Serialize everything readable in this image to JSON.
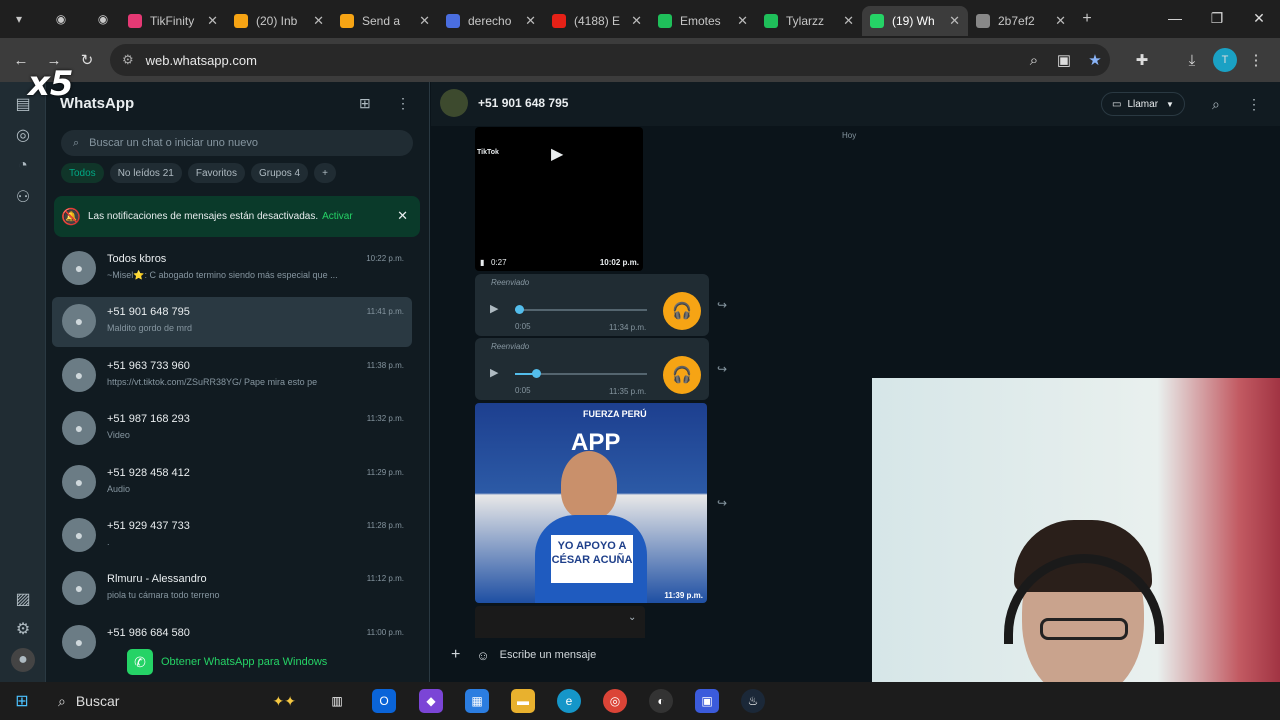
{
  "browser": {
    "tabs": [
      {
        "title": "TikFinity",
        "color": "#e53974"
      },
      {
        "title": "(20) Inb",
        "color": "#f6a414"
      },
      {
        "title": "Send a",
        "color": "#f6a414"
      },
      {
        "title": "derecho",
        "color": "#4a6ee0"
      },
      {
        "title": "(4188) E",
        "color": "#e62117"
      },
      {
        "title": "Emotes",
        "color": "#1fbf5a"
      },
      {
        "title": "Tylarzz",
        "color": "#1fbf5a"
      },
      {
        "title": "(19) Wh",
        "color": "#25d366"
      },
      {
        "title": "2b7ef2",
        "color": "#888888"
      }
    ],
    "url": "web.whatsapp.com"
  },
  "app": {
    "title": "WhatsApp",
    "search_placeholder": "Buscar un chat o iniciar uno nuevo",
    "filters": [
      "Todos",
      "No leídos 21",
      "Favoritos",
      "Grupos 4",
      "+"
    ],
    "notice": {
      "text": "Las notificaciones de mensajes están desactivadas.",
      "action": "Activar"
    },
    "chats": [
      {
        "name": "Todos kbros",
        "time": "10:22 p.m.",
        "preview": "~Misel⭐: C abogado termino siendo más especial que ..."
      },
      {
        "name": "+51 901 648 795",
        "time": "11:41 p.m.",
        "preview": "Maldito gordo de mrd"
      },
      {
        "name": "+51 963 733 960",
        "time": "11:38 p.m.",
        "preview": "https://vt.tiktok.com/ZSuRR38YG/  Pape mira esto pe"
      },
      {
        "name": "+51 987 168 293",
        "time": "11:32 p.m.",
        "preview": "Video"
      },
      {
        "name": "+51 928 458 412",
        "time": "11:29 p.m.",
        "preview": "Audio"
      },
      {
        "name": "+51 929 437 733",
        "time": "11:28 p.m.",
        "preview": "."
      },
      {
        "name": "Rlmuru - Alessandro",
        "time": "11:12 p.m.",
        "preview": "piola tu cámara todo terreno"
      },
      {
        "name": "+51 986 684 580",
        "time": "11:00 p.m.",
        "preview": ""
      }
    ],
    "get_windows": "Obtener WhatsApp para Windows",
    "conversation": {
      "contact": "+51 901 648 795",
      "call": "Llamar",
      "date_chip": "Hoy",
      "video": {
        "duration": "0:27",
        "time": "10:02 p.m.",
        "brand": "TikTok"
      },
      "audios": [
        {
          "forwarded": "Reenviado",
          "duration": "0:05",
          "time": "11:34 p.m.",
          "progress": 0.0
        },
        {
          "forwarded": "Reenviado",
          "duration": "0:05",
          "time": "11:35 p.m.",
          "progress": 0.15
        }
      ],
      "image": {
        "time": "11:39 p.m.",
        "caption": "YO APOYO A CÉSAR ACUÑA",
        "banner": "FUERZA PERÚ",
        "logo": "APP"
      },
      "composer_placeholder": "Escribe un mensaje"
    }
  },
  "overlay": {
    "badge": "x5"
  },
  "taskbar": {
    "search": "Buscar"
  }
}
